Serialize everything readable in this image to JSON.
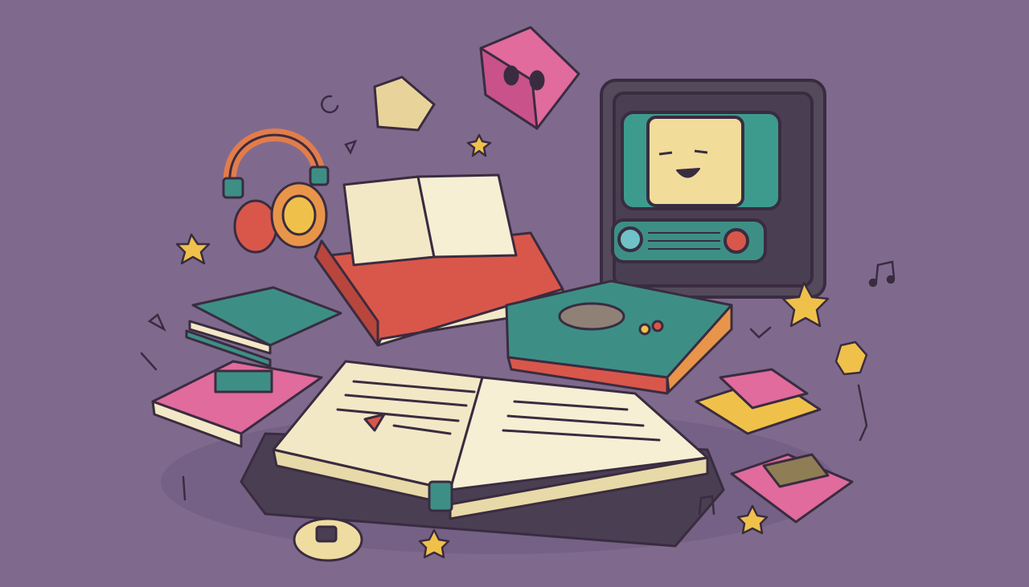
{
  "scene": {
    "elements": [
      "headphones",
      "open-book",
      "stacked-books",
      "retro-tv-radio",
      "game-console-book",
      "pink-cube",
      "stars",
      "music-notes",
      "coin"
    ]
  },
  "palette": {
    "background": "#7f6a8e",
    "outline": "#3a2c40",
    "paper": "#f3e8c6",
    "red": "#d9574a",
    "teal": "#3d8f86",
    "pink": "#e06b9c",
    "yellow": "#f0c14a",
    "tv_body": "#55495c",
    "screen": "#3d9b8e",
    "face": "#f1dc9a"
  }
}
